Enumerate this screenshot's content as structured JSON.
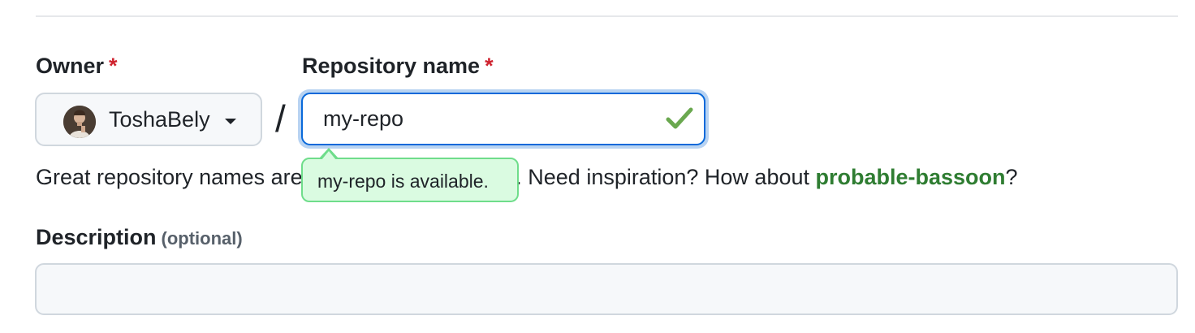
{
  "owner": {
    "label": "Owner",
    "required_marker": "*",
    "selected_name": "ToshaBely",
    "avatar_icon": "user-avatar",
    "dropdown_icon": "caret-down-icon"
  },
  "separator": "/",
  "repository": {
    "label": "Repository name",
    "required_marker": "*",
    "value": "my-repo",
    "status_icon": "check-icon",
    "availability_tooltip": "my-repo is available."
  },
  "help": {
    "text_before": "Great repository names are short and memorable. Need inspiration? How about ",
    "suggestion": "probable-bassoon",
    "text_after": "?"
  },
  "description": {
    "label": "Description",
    "optional_note": "(optional)",
    "value": "",
    "placeholder": ""
  },
  "colors": {
    "accent_blue": "#0969da",
    "required_red": "#cf222e",
    "success_green": "#2f7d32",
    "tooltip_bg": "#dafbe1",
    "tooltip_border": "#6fdd8b",
    "check_green": "#6aa84f"
  }
}
